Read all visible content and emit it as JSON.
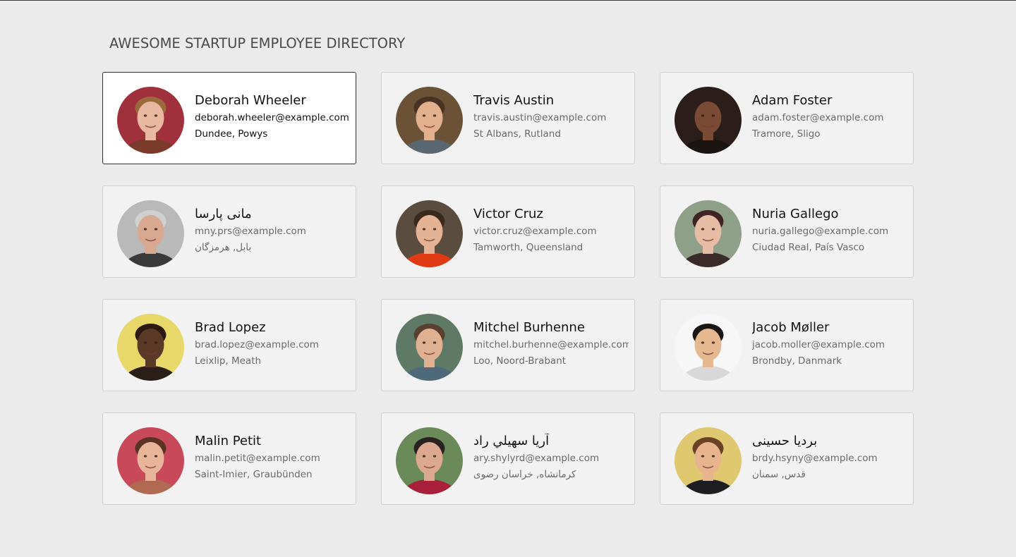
{
  "header": {
    "title": "AWESOME STARTUP EMPLOYEE DIRECTORY"
  },
  "employees": [
    {
      "name": "Deborah Wheeler",
      "email": "deborah.wheeler@example.com",
      "location": "Dundee, Powys",
      "active": true,
      "avatar": {
        "bg": "#a0303c",
        "skin": "#e8b8a0",
        "hair": "#9a6a3a",
        "shirt": "#7a3b2a"
      }
    },
    {
      "name": "Travis Austin",
      "email": "travis.austin@example.com",
      "location": "St Albans, Rutland",
      "active": false,
      "avatar": {
        "bg": "#6b5236",
        "skin": "#e3b08e",
        "hair": "#4a3222",
        "shirt": "#5a6670"
      }
    },
    {
      "name": "Adam Foster",
      "email": "adam.foster@example.com",
      "location": "Tramore, Sligo",
      "active": false,
      "avatar": {
        "bg": "#2a1d1a",
        "skin": "#7a4a34",
        "hair": "#2a1d1a",
        "shirt": "#1a1412"
      }
    },
    {
      "name": "مانی پارسا",
      "email": "mny.prs@example.com",
      "location": "بابل, هرمزگان",
      "active": false,
      "avatar": {
        "bg": "#b9b9b9",
        "skin": "#d8a890",
        "hair": "#d0d0d0",
        "shirt": "#3a3a3a"
      }
    },
    {
      "name": "Victor Cruz",
      "email": "victor.cruz@example.com",
      "location": "Tamworth, Queensland",
      "active": false,
      "avatar": {
        "bg": "#5a4c3e",
        "skin": "#e4b394",
        "hair": "#3a2a1e",
        "shirt": "#e03a14"
      }
    },
    {
      "name": "Nuria Gallego",
      "email": "nuria.gallego@example.com",
      "location": "Ciudad Real, País Vasco",
      "active": false,
      "avatar": {
        "bg": "#8fa088",
        "skin": "#e6bca4",
        "hair": "#3e2424",
        "shirt": "#3a2a2a"
      }
    },
    {
      "name": "Brad Lopez",
      "email": "brad.lopez@example.com",
      "location": "Leixlip, Meath",
      "active": false,
      "avatar": {
        "bg": "#e8d86a",
        "skin": "#5a3a26",
        "hair": "#2a1a12",
        "shirt": "#2a1e18"
      }
    },
    {
      "name": "Mitchel Burhenne",
      "email": "mitchel.burhenne@example.com",
      "location": "Loo, Noord-Brabant",
      "active": false,
      "avatar": {
        "bg": "#5e7a66",
        "skin": "#e0b092",
        "hair": "#5a4030",
        "shirt": "#4e6a7a"
      }
    },
    {
      "name": "Jacob Møller",
      "email": "jacob.moller@example.com",
      "location": "Brondby, Danmark",
      "active": false,
      "avatar": {
        "bg": "#f7f7f7",
        "skin": "#e6b890",
        "hair": "#1a1614",
        "shirt": "#d8d8d8"
      }
    },
    {
      "name": "Malin Petit",
      "email": "malin.petit@example.com",
      "location": "Saint-Imier, Graubünden",
      "active": false,
      "avatar": {
        "bg": "#c84a5a",
        "skin": "#e8b49a",
        "hair": "#5a3322",
        "shirt": "#b06a52"
      }
    },
    {
      "name": "آریا سهيلي راد",
      "email": "ary.shylyrd@example.com",
      "location": "کرمانشاه, خراسان رضوی",
      "active": false,
      "avatar": {
        "bg": "#6a8a5a",
        "skin": "#dca890",
        "hair": "#2a2220",
        "shirt": "#a8203a"
      }
    },
    {
      "name": "بردیا حسینی",
      "email": "brdy.hsyny@example.com",
      "location": "قدس, سمنان",
      "active": false,
      "avatar": {
        "bg": "#e0c870",
        "skin": "#e8b48e",
        "hair": "#6a4226",
        "shirt": "#1e1e22"
      }
    }
  ]
}
